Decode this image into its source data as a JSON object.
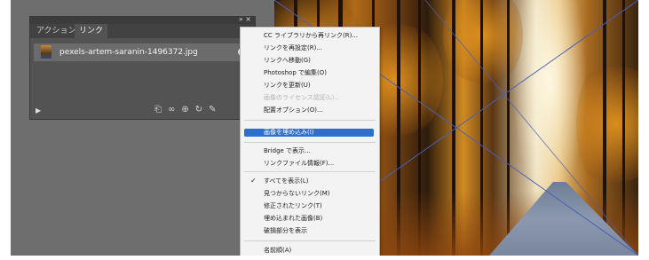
{
  "panel": {
    "tabs": [
      {
        "label": "アクション",
        "active": false
      },
      {
        "label": "リンク",
        "active": true
      }
    ],
    "top_controls": "» ×",
    "menu_button": "≡",
    "link_file": "pexels-artem-saranin-1496372.jpg",
    "footer_icons": [
      "relink-from-cc-icon",
      "relink-icon",
      "go-to-link-icon",
      "update-link-icon",
      "edit-original-icon"
    ]
  },
  "context_menu": {
    "items": [
      {
        "label": "CC ライブラリから再リンク(R)...",
        "disabled": false
      },
      {
        "label": "リンクを再設定(R)...",
        "disabled": false
      },
      {
        "label": "リンクへ移動(G)",
        "disabled": false
      },
      {
        "label": "Photoshop で編集(O)",
        "disabled": false
      },
      {
        "label": "リンクを更新(U)",
        "disabled": false
      },
      {
        "label": "画像のライセンス認証(L)...",
        "disabled": true
      },
      {
        "label": "配置オプション(O)...",
        "disabled": false
      },
      {
        "label": "画像を埋め込み(I)",
        "highlighted": true
      },
      {
        "label": "Bridge で表示...",
        "disabled": false
      },
      {
        "label": "リンクファイル情報(F)...",
        "disabled": false
      },
      {
        "label": "すべてを表示(L)",
        "checked": true
      },
      {
        "label": "見つからないリンク(M)",
        "disabled": false
      },
      {
        "label": "修正されたリンク(T)",
        "disabled": false
      },
      {
        "label": "埋め込まれた画像(B)",
        "disabled": false
      },
      {
        "label": "破損部分を表示",
        "disabled": false
      },
      {
        "label": "名前順(A)",
        "disabled": false
      }
    ]
  },
  "colors": {
    "highlight": "#2d6fcf",
    "panel_bg": "#535353",
    "canvas_bg": "#6e6e6e"
  }
}
